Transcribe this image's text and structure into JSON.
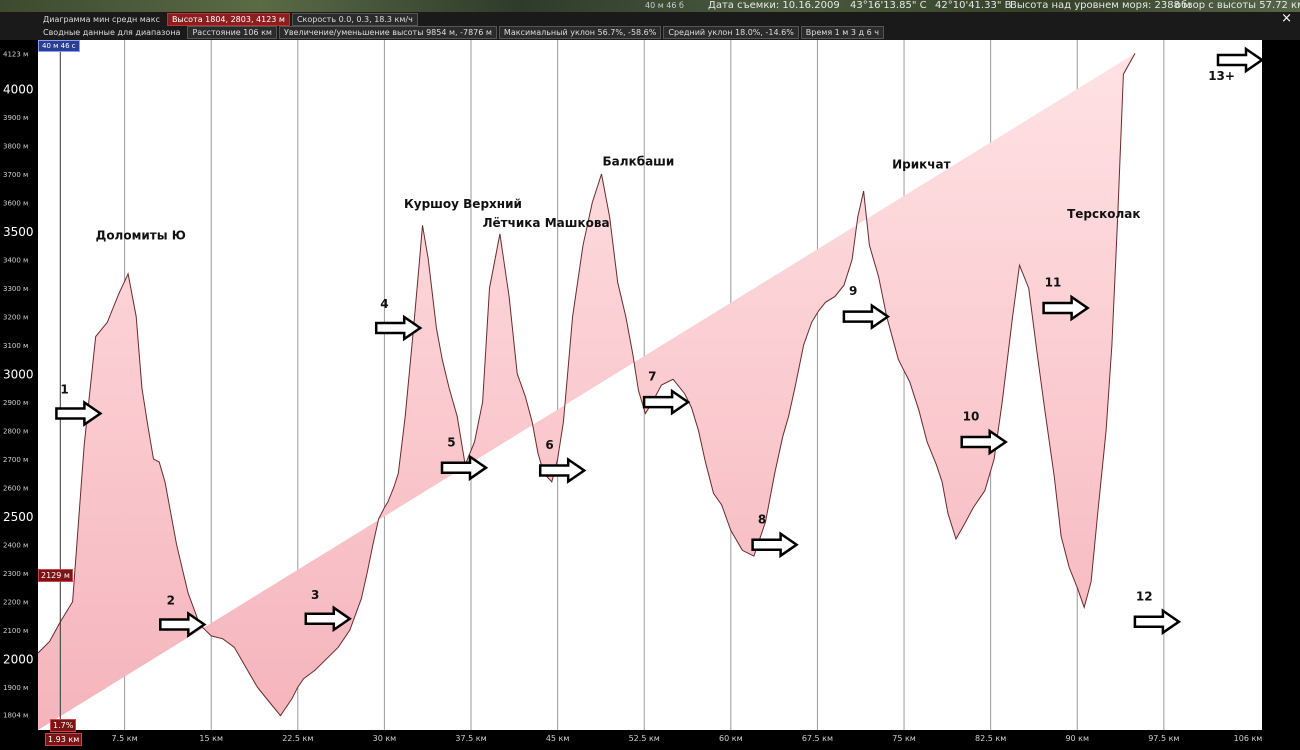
{
  "status": {
    "date": "Дата съемки: 10.16.2009",
    "lat": "43°16'13.85\" С",
    "lon": "42°10'41.33\" В",
    "alt": "Высота над уровнем моря: 2388 м",
    "view": "обзор с высоты 57.72 км",
    "zoom": "40 м 46 б"
  },
  "toolbar1": {
    "label": "Диаграмма  мин  средн  макс",
    "height": "Высота 1804, 2803, 4123 м",
    "speed": "Скорость 0.0, 0.3, 18.3 км/ч"
  },
  "toolbar2": {
    "label": "Сводные данные для диапазона",
    "distance": "Расстояние 106 км",
    "gain": "Увеличение/уменьшение высоты 9854 м, -7876 м",
    "maxslope": "Максимальный уклон 56.7%, -58.6%",
    "avgslope": "Средний уклон 18.0%, -14.6%",
    "time": "Время 1 м 3 д 6 ч"
  },
  "cursor": {
    "tag": "40 м 46 с",
    "alt_badge": "2129 м",
    "slope_badge": "1.7%",
    "dist_badge": "1.93 км"
  },
  "close_label": "×",
  "chart_data": {
    "type": "area",
    "xlim": [
      0,
      106
    ],
    "ylim": [
      1750,
      4170
    ],
    "y_small_ticks": [
      {
        "v": 4123,
        "label": "4123 м"
      },
      {
        "v": 3900,
        "label": "3900 м"
      },
      {
        "v": 3800,
        "label": "3800 м"
      },
      {
        "v": 3700,
        "label": "3700 м"
      },
      {
        "v": 3600,
        "label": "3600 м"
      },
      {
        "v": 3400,
        "label": "3400 м"
      },
      {
        "v": 3300,
        "label": "3300 м"
      },
      {
        "v": 3200,
        "label": "3200 м"
      },
      {
        "v": 3100,
        "label": "3100 м"
      },
      {
        "v": 2900,
        "label": "2900 м"
      },
      {
        "v": 2800,
        "label": "2800 м"
      },
      {
        "v": 2700,
        "label": "2700 м"
      },
      {
        "v": 2600,
        "label": "2600 м"
      },
      {
        "v": 2400,
        "label": "2400 м"
      },
      {
        "v": 2300,
        "label": "2300 м"
      },
      {
        "v": 2200,
        "label": "2200 м"
      },
      {
        "v": 2100,
        "label": "2100 м"
      },
      {
        "v": 1900,
        "label": "1900 м"
      },
      {
        "v": 1804,
        "label": "1804 м"
      }
    ],
    "y_big_ticks": [
      {
        "v": 4000,
        "label": "4000"
      },
      {
        "v": 3500,
        "label": "3500"
      },
      {
        "v": 3000,
        "label": "3000"
      },
      {
        "v": 2500,
        "label": "2500"
      },
      {
        "v": 2000,
        "label": "2000"
      }
    ],
    "x_ticks": [
      {
        "v": 7.5,
        "label": "7.5 км"
      },
      {
        "v": 15,
        "label": "15 км"
      },
      {
        "v": 22.5,
        "label": "22.5 км"
      },
      {
        "v": 30,
        "label": "30 км"
      },
      {
        "v": 37.5,
        "label": "37.5 км"
      },
      {
        "v": 45,
        "label": "45 км"
      },
      {
        "v": 52.5,
        "label": "52.5 км"
      },
      {
        "v": 60,
        "label": "60 км"
      },
      {
        "v": 67.5,
        "label": "67.5 км"
      },
      {
        "v": 75,
        "label": "75 км"
      },
      {
        "v": 82.5,
        "label": "82.5 км"
      },
      {
        "v": 90,
        "label": "90 км"
      },
      {
        "v": 97.5,
        "label": "97.5 км"
      },
      {
        "v": 106,
        "label": "106 км"
      }
    ],
    "cursor_x": 1.93,
    "profile_x": [
      0,
      1.0,
      1.93,
      3.0,
      4.0,
      5.0,
      6.0,
      7.0,
      7.8,
      8.5,
      9.0,
      9.5,
      10.0,
      10.5,
      11.0,
      12.0,
      13.0,
      14.0,
      15.0,
      16.0,
      17.0,
      18.0,
      19.0,
      20.0,
      21.0,
      22.0,
      22.5,
      23.0,
      24.0,
      25.0,
      26.0,
      27.0,
      28.0,
      28.5,
      29.0,
      29.5,
      30.0,
      30.3,
      30.8,
      31.2,
      31.8,
      32.5,
      33.0,
      33.3,
      33.8,
      34.5,
      35.0,
      35.6,
      36.3,
      37.0,
      37.8,
      38.5,
      39.1,
      40.0,
      40.8,
      41.5,
      42.2,
      42.8,
      43.3,
      43.8,
      44.5,
      45.0,
      45.5,
      46.3,
      47.2,
      48.0,
      48.8,
      49.5,
      50.2,
      50.9,
      51.5,
      52.0,
      52.6,
      53.2,
      54.0,
      55.0,
      56.0,
      56.6,
      57.2,
      57.8,
      58.5,
      59.2,
      60.0,
      61.0,
      62.0,
      63.0,
      63.8,
      64.5,
      65.0,
      65.6,
      66.3,
      67.0,
      67.6,
      68.2,
      69.0,
      69.8,
      70.5,
      71.0,
      71.5,
      72.0,
      72.8,
      73.5,
      74.5,
      75.5,
      76.3,
      77.0,
      77.8,
      78.3,
      78.8,
      79.5,
      80.2,
      81.0,
      82.0,
      82.8,
      83.5,
      84.4,
      85.0,
      85.8,
      86.5,
      87.2,
      88.0,
      88.6,
      89.3,
      90.0,
      90.6,
      91.2,
      91.8,
      92.5,
      93.0,
      93.5,
      94.0,
      95.0,
      96.0,
      97.0,
      98.0,
      98.6,
      99.5,
      100.5,
      101.5,
      102.5,
      103.5,
      104.3,
      105.0,
      105.5,
      106.0
    ],
    "profile_y": [
      2020,
      2060,
      2129,
      2200,
      2750,
      3130,
      3180,
      3280,
      3350,
      3200,
      2950,
      2820,
      2700,
      2690,
      2620,
      2400,
      2230,
      2120,
      2080,
      2070,
      2040,
      1970,
      1900,
      1850,
      1800,
      1860,
      1900,
      1930,
      1960,
      2000,
      2040,
      2100,
      2210,
      2300,
      2400,
      2490,
      2530,
      2550,
      2600,
      2650,
      2850,
      3150,
      3380,
      3520,
      3400,
      3160,
      3050,
      2950,
      2850,
      2680,
      2760,
      2900,
      3300,
      3490,
      3270,
      3000,
      2920,
      2830,
      2720,
      2650,
      2620,
      2700,
      2830,
      3200,
      3450,
      3600,
      3700,
      3550,
      3320,
      3200,
      3070,
      2940,
      2860,
      2900,
      2960,
      2980,
      2930,
      2880,
      2800,
      2690,
      2580,
      2540,
      2450,
      2380,
      2360,
      2480,
      2650,
      2780,
      2850,
      2960,
      3100,
      3180,
      3220,
      3250,
      3270,
      3310,
      3400,
      3550,
      3640,
      3450,
      3340,
      3200,
      3050,
      2970,
      2870,
      2760,
      2680,
      2620,
      2510,
      2420,
      2470,
      2530,
      2590,
      2700,
      2900,
      3200,
      3380,
      3300,
      3080,
      2870,
      2640,
      2430,
      2320,
      2250,
      2180,
      2270,
      2520,
      2800,
      3100,
      3550,
      4050,
      4123
    ],
    "series": [
      {
        "name": "",
        "values": []
      }
    ],
    "annotations": [
      {
        "text": "Доломиты Ю",
        "x": 8.9,
        "y": 3470
      },
      {
        "text": "Куршоу Верхний",
        "x": 36.8,
        "y": 3580
      },
      {
        "text": "Лётчика Машкова",
        "x": 44.0,
        "y": 3515
      },
      {
        "text": "Балкбаши",
        "x": 52.0,
        "y": 3730
      },
      {
        "text": "Ирикчат",
        "x": 76.5,
        "y": 3720
      },
      {
        "text": "Терсколак",
        "x": 92.3,
        "y": 3545
      }
    ],
    "markers": [
      {
        "label": "1",
        "x": 5.4,
        "y": 2860,
        "lx": 2.3,
        "ly": 2930
      },
      {
        "label": "2",
        "x": 14.4,
        "y": 2120,
        "lx": 11.5,
        "ly": 2190
      },
      {
        "label": "3",
        "x": 27.0,
        "y": 2140,
        "lx": 24.0,
        "ly": 2210
      },
      {
        "label": "4",
        "x": 33.1,
        "y": 3160,
        "lx": 30.0,
        "ly": 3230
      },
      {
        "label": "5",
        "x": 38.8,
        "y": 2670,
        "lx": 35.8,
        "ly": 2745
      },
      {
        "label": "6",
        "x": 47.3,
        "y": 2660,
        "lx": 44.3,
        "ly": 2735
      },
      {
        "label": "7",
        "x": 56.3,
        "y": 2900,
        "lx": 53.2,
        "ly": 2975
      },
      {
        "label": "8",
        "x": 65.7,
        "y": 2400,
        "lx": 62.7,
        "ly": 2475
      },
      {
        "label": "9",
        "x": 73.6,
        "y": 3200,
        "lx": 70.6,
        "ly": 3275
      },
      {
        "label": "10",
        "x": 83.8,
        "y": 2760,
        "lx": 80.8,
        "ly": 2835
      },
      {
        "label": "11",
        "x": 90.9,
        "y": 3230,
        "lx": 87.9,
        "ly": 3305
      },
      {
        "label": "12",
        "x": 98.8,
        "y": 2130,
        "lx": 95.8,
        "ly": 2205
      },
      {
        "label": "13+",
        "x": 106.0,
        "y": 4100,
        "lx": 102.5,
        "ly": 4030
      }
    ]
  }
}
